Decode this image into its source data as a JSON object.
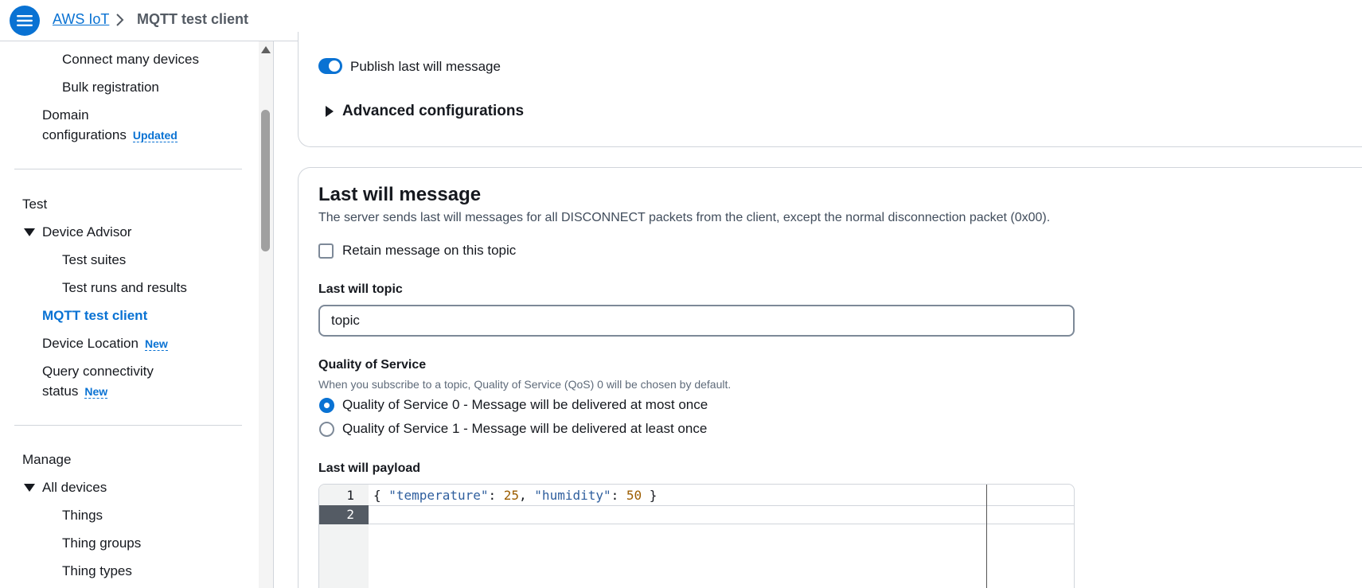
{
  "header": {
    "root_crumb": "AWS IoT",
    "current_crumb": "MQTT test client"
  },
  "sidebar": {
    "items_top": [
      {
        "label": "Connect many devices"
      },
      {
        "label": "Bulk registration"
      }
    ],
    "domain": {
      "line1": "Domain",
      "line2": "configurations",
      "badge": "Updated"
    },
    "test_section": "Test",
    "device_advisor": "Device Advisor",
    "test_suites": "Test suites",
    "test_runs": "Test runs and results",
    "mqtt_client": "MQTT test client",
    "device_location": {
      "label": "Device Location",
      "badge": "New"
    },
    "query_conn": {
      "line1": "Query connectivity",
      "line2": "status",
      "badge": "New"
    },
    "manage_section": "Manage",
    "all_devices": "All devices",
    "things": "Things",
    "thing_groups": "Thing groups",
    "thing_types": "Thing types"
  },
  "card1": {
    "toggle_label": "Publish last will message",
    "advanced": "Advanced configurations"
  },
  "lastwill": {
    "title": "Last will message",
    "description": "The server sends last will messages for all DISCONNECT packets from the client, except the normal disconnection packet (0x00).",
    "retain_label": "Retain message on this topic",
    "topic_label": "Last will topic",
    "topic_value": "topic",
    "qos_label": "Quality of Service",
    "qos_hint": "When you subscribe to a topic, Quality of Service (QoS) 0 will be chosen by default.",
    "qos0": "Quality of Service 0 - Message will be delivered at most once",
    "qos1": "Quality of Service 1 - Message will be delivered at least once",
    "payload_label": "Last will payload",
    "payload": {
      "line_numbers": [
        "1",
        "2"
      ],
      "tokens": {
        "open": "{ ",
        "k1": "\"temperature\"",
        "sep1": ": ",
        "v1": "25",
        "comma": ", ",
        "k2": "\"humidity\"",
        "sep2": ": ",
        "v2": "50",
        "close": " }"
      }
    }
  },
  "colors": {
    "accent": "#0972d3",
    "border": "#d1d5db",
    "text": "#16191f"
  }
}
